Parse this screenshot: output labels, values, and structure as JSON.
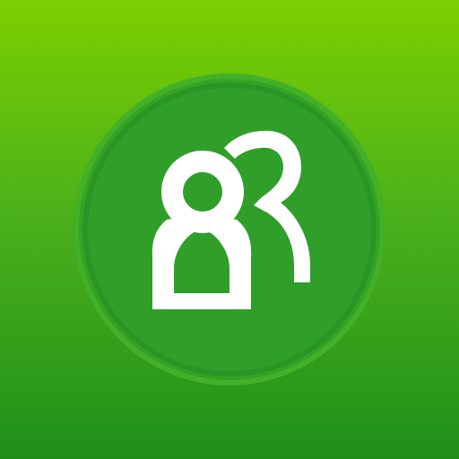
{
  "app": {
    "icon_name": "people-icon",
    "accent_colors": {
      "bg_top": "#7ccf00",
      "bg_bottom": "#1f8f1a",
      "badge": "#2f9f2a",
      "glyph": "#ffffff"
    }
  }
}
